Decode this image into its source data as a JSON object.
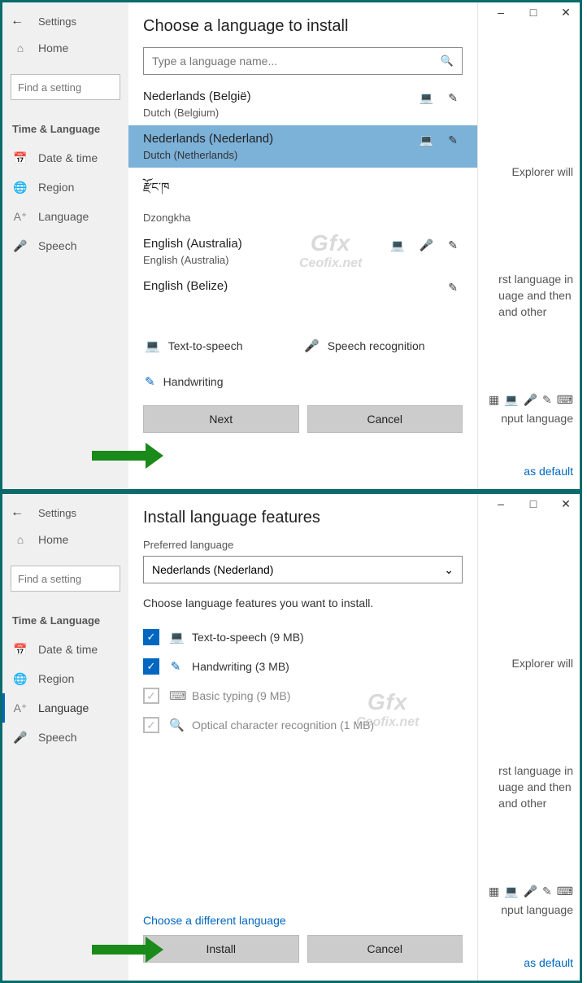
{
  "win1": {
    "settings_title": "Settings",
    "home": "Home",
    "search_placeholder": "Find a setting",
    "category": "Time & Language",
    "nav": {
      "date": "Date & time",
      "region": "Region",
      "language": "Language",
      "speech": "Speech"
    },
    "dialog": {
      "title": "Choose a language to install",
      "search_placeholder": "Type a language name...",
      "languages": [
        {
          "name": "Nederlands (België)",
          "sub": "Dutch (Belgium)",
          "icons": [
            "display",
            "hand"
          ],
          "selected": false
        },
        {
          "name": "Nederlands (Nederland)",
          "sub": "Dutch (Netherlands)",
          "icons": [
            "display",
            "hand"
          ],
          "selected": true
        },
        {
          "name": "རྫོང་ཁ",
          "sub": "Dzongkha",
          "icons": [],
          "selected": false
        },
        {
          "name": "English (Australia)",
          "sub": "English (Australia)",
          "icons": [
            "display",
            "mic",
            "hand"
          ],
          "selected": false
        },
        {
          "name": "English (Belize)",
          "sub": "",
          "icons": [
            "hand"
          ],
          "selected": false
        }
      ],
      "legend": {
        "tts": "Text-to-speech",
        "speech": "Speech recognition",
        "hand": "Handwriting"
      },
      "next": "Next",
      "cancel": "Cancel"
    },
    "bg": {
      "line1": "Explorer will",
      "line2a": "rst language in",
      "line2b": "uage and then",
      "line2c": "and other",
      "input": "nput language",
      "default": "as default"
    },
    "watermark": {
      "top": "Gfx",
      "bottom": "Ceofix.net"
    }
  },
  "win2": {
    "settings_title": "Settings",
    "home": "Home",
    "search_placeholder": "Find a setting",
    "category": "Time & Language",
    "nav": {
      "date": "Date & time",
      "region": "Region",
      "language": "Language",
      "speech": "Speech"
    },
    "dialog": {
      "title": "Install language features",
      "pref_label": "Preferred language",
      "pref_value": "Nederlands (Nederland)",
      "choose_text": "Choose language features you want to install.",
      "features": {
        "tts": "Text-to-speech (9 MB)",
        "hand": "Handwriting (3 MB)",
        "basic": "Basic typing (9 MB)",
        "ocr": "Optical character recognition (1 MB)"
      },
      "diff_lang": "Choose a different language",
      "install": "Install",
      "cancel": "Cancel"
    },
    "bg": {
      "line1": "Explorer will",
      "line2a": "rst language in",
      "line2b": "uage and then",
      "line2c": "and other",
      "input": "nput language",
      "default": "as default"
    },
    "watermark": {
      "top": "Gfx",
      "bottom": "Ceofix.net"
    }
  }
}
